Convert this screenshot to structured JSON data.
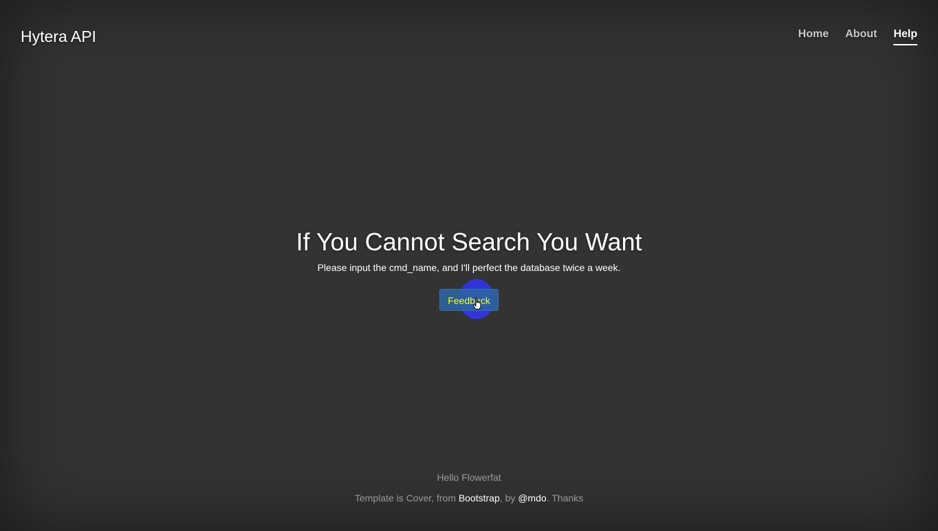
{
  "header": {
    "brand": "Hytera API",
    "nav": [
      {
        "label": "Home",
        "active": false
      },
      {
        "label": "About",
        "active": false
      },
      {
        "label": "Help",
        "active": true
      }
    ]
  },
  "main": {
    "heading": "If You Cannot Search You Want",
    "lead": "Please input the cmd_name, and I'll perfect the database twice a week.",
    "button_label": "Feedback"
  },
  "footer": {
    "greeting": "Hello Flowerfat",
    "credit_prefix": "Template is Cover, from ",
    "bootstrap_link": "Bootstrap",
    "credit_mid": ", by ",
    "author_link": "@mdo",
    "credit_suffix": ". Thanks"
  },
  "colors": {
    "background": "#333333",
    "button_background": "#2d64a0",
    "button_text": "#f2ff2a",
    "click_highlight": "#2f35d8"
  },
  "icons": {
    "cursor": "hand-pointer-cursor-icon"
  }
}
